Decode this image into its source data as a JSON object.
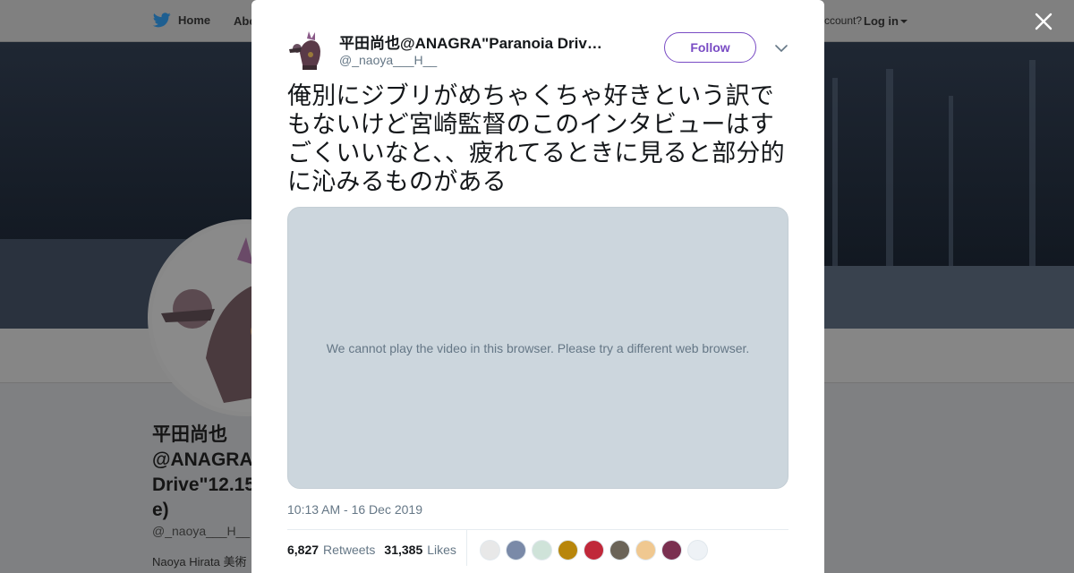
{
  "nav": {
    "home_label": "Home",
    "about_label": "Abo",
    "account_prompt": "ccount?",
    "login_label": "Log in"
  },
  "profile": {
    "name": "平田尚也\n@ANAGRA\nDrive\"12.15\ne)",
    "handle": "@_naoya___H__",
    "bio": "Naoya Hirata 美術"
  },
  "tweet": {
    "author_name": "平田尚也@ANAGRA\"Paranoia Driv…",
    "author_handle": "@_naoya___H__",
    "follow_label": "Follow",
    "text": "俺別にジブリがめちゃくちゃ好きという訳でもないけど宮崎監督のこのインタビューはすごくいいなと、、疲れてるときに見ると部分的に沁みるものがある",
    "video_message": "We cannot play the video in this browser. Please try a different web browser.",
    "timestamp": "10:13 AM - 16 Dec 2019",
    "retweets_count": "6,827",
    "retweets_label": "Retweets",
    "likes_count": "31,385",
    "likes_label": "Likes"
  },
  "colors": {
    "accent": "#794bc4",
    "secondary_text": "#657786",
    "video_placeholder": "#ccd6dd",
    "overlay": "#7f8082"
  },
  "likers": [
    {
      "icon": "sketch-avatar-icon",
      "color": "#e8e8e8"
    },
    {
      "icon": "anime-avatar-icon",
      "color": "#7a8aa8"
    },
    {
      "icon": "mascot-avatar-icon",
      "color": "#cfe3d9"
    },
    {
      "icon": "cat-avatar-icon",
      "color": "#b8860b"
    },
    {
      "icon": "red-character-avatar-icon",
      "color": "#c0283a"
    },
    {
      "icon": "photo-avatar-icon",
      "color": "#6b6458"
    },
    {
      "icon": "blonde-character-avatar-icon",
      "color": "#f0c890"
    },
    {
      "icon": "purple-character-avatar-icon",
      "color": "#7a3050"
    },
    {
      "icon": "doodle-avatar-icon",
      "color": "#eef2f6"
    }
  ]
}
